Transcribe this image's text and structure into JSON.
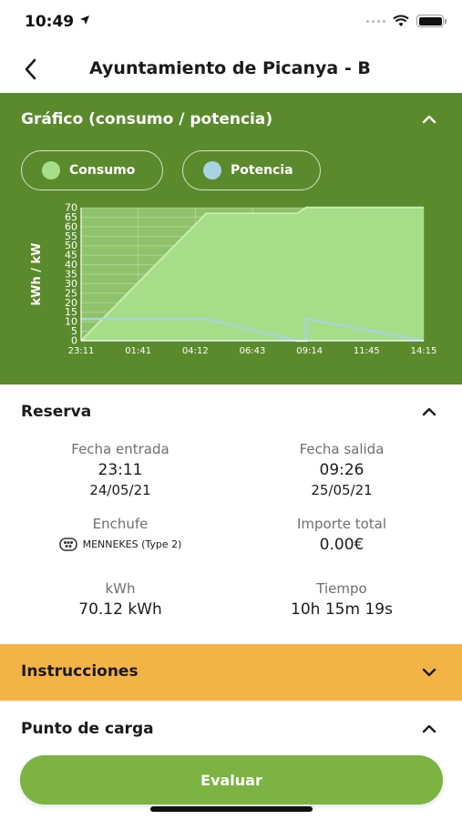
{
  "status_bar": {
    "time": "10:49"
  },
  "nav": {
    "title": "Ayuntamiento de Picanya - B"
  },
  "graph": {
    "title": "Gráfico (consumo / potencia)",
    "legend": [
      {
        "label": "Consumo",
        "color": "#a8de8a"
      },
      {
        "label": "Potencia",
        "color": "#a9d3e0"
      }
    ],
    "colors": {
      "background": "#5a8a2c",
      "plot_bg": "#8fc26a",
      "consumo_fill": "#a8de8a",
      "potencia_line": "#a9d3e0"
    }
  },
  "chart_data": {
    "type": "area",
    "ylabel": "kWh / kW",
    "ylim": [
      0,
      70
    ],
    "yticks": [
      0,
      5,
      10,
      15,
      20,
      25,
      30,
      35,
      40,
      45,
      50,
      55,
      60,
      65,
      70
    ],
    "xticks": [
      "23:11",
      "01:41",
      "04:12",
      "06:43",
      "09:14",
      "11:45",
      "14:15"
    ],
    "xlim_hours": [
      0,
      15.07
    ],
    "grid": true,
    "series": [
      {
        "name": "Consumo",
        "points": [
          [
            0,
            0
          ],
          [
            5.5,
            67
          ],
          [
            9.5,
            67
          ],
          [
            9.9,
            70.12
          ],
          [
            15.07,
            70.12
          ]
        ]
      },
      {
        "name": "Potencia",
        "points": [
          [
            0,
            11.5
          ],
          [
            5.5,
            11.5
          ],
          [
            9.5,
            0
          ],
          [
            9.9,
            0
          ],
          [
            9.9,
            11.5
          ],
          [
            15.07,
            0
          ]
        ]
      }
    ]
  },
  "reserva": {
    "title": "Reserva",
    "fecha_entrada": {
      "label": "Fecha entrada",
      "time": "23:11",
      "date": "24/05/21"
    },
    "fecha_salida": {
      "label": "Fecha salida",
      "time": "09:26",
      "date": "25/05/21"
    },
    "enchufe": {
      "label": "Enchufe",
      "value": "MENNEKES (Type 2)"
    },
    "importe": {
      "label": "Importe total",
      "value": "0.00€"
    },
    "kwh": {
      "label": "kWh",
      "value": "70.12 kWh"
    },
    "tiempo": {
      "label": "Tiempo",
      "value": "10h 15m 19s"
    }
  },
  "instrucciones": {
    "label": "Instrucciones"
  },
  "punto": {
    "label": "Punto de carga"
  },
  "evaluar": {
    "label": "Evaluar"
  }
}
